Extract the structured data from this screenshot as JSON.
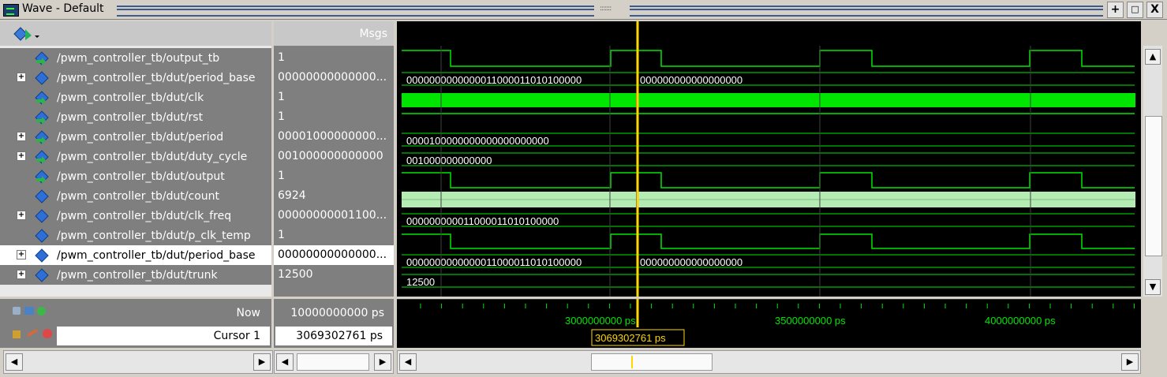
{
  "window": {
    "title": "Wave - Default",
    "grip_text": ":::::::",
    "btn_add": "+",
    "btn_float": "□",
    "btn_close": "X"
  },
  "header": {
    "msgs_label": "Msgs"
  },
  "signals": [
    {
      "name": "/pwm_controller_tb/output_tb",
      "value": "1",
      "expandable": false,
      "type": "input"
    },
    {
      "name": "/pwm_controller_tb/dut/period_base",
      "value": "00000000000000...",
      "expandable": true,
      "type": "internal"
    },
    {
      "name": "/pwm_controller_tb/dut/clk",
      "value": "1",
      "expandable": false,
      "type": "input"
    },
    {
      "name": "/pwm_controller_tb/dut/rst",
      "value": "1",
      "expandable": false,
      "type": "input"
    },
    {
      "name": "/pwm_controller_tb/dut/period",
      "value": "00001000000000...",
      "expandable": true,
      "type": "input"
    },
    {
      "name": "/pwm_controller_tb/dut/duty_cycle",
      "value": "001000000000000",
      "expandable": true,
      "type": "input"
    },
    {
      "name": "/pwm_controller_tb/dut/output",
      "value": "1",
      "expandable": false,
      "type": "output"
    },
    {
      "name": "/pwm_controller_tb/dut/count",
      "value": "6924",
      "expandable": false,
      "type": "internal"
    },
    {
      "name": "/pwm_controller_tb/dut/clk_freq",
      "value": "00000000001100...",
      "expandable": true,
      "type": "internal"
    },
    {
      "name": "/pwm_controller_tb/dut/p_clk_temp",
      "value": "1",
      "expandable": false,
      "type": "internal"
    },
    {
      "name": "/pwm_controller_tb/dut/period_base",
      "value": "00000000000000...",
      "expandable": true,
      "type": "internal",
      "selected": true
    },
    {
      "name": "/pwm_controller_tb/dut/trunk",
      "value": "12500",
      "expandable": true,
      "type": "internal"
    }
  ],
  "wave_labels": {
    "period_base_a": "0000000000000011000011010100000",
    "period_base_b": "000000000000000000",
    "period": "0000100000000000000000000",
    "duty_cycle": "001000000000000",
    "clk_freq": "000000000011000011010100000",
    "period_base2_a": "0000000000000011000011010100000",
    "period_base2_b": "000000000000000000",
    "trunk": "12500"
  },
  "footer": {
    "now_label": "Now",
    "now_value": "10000000000 ps",
    "cursor_label": "Cursor 1",
    "cursor_value": "3069302761 ps",
    "cursor_flag": "3069302761 ps",
    "ticks": [
      "3000000000 ps",
      "3500000000 ps",
      "4000000000 ps"
    ]
  },
  "colors": {
    "wave": "#00e600",
    "cursor": "#ffd700",
    "count_fill": "#b4ecb4",
    "flag_border": "#ffd700"
  }
}
